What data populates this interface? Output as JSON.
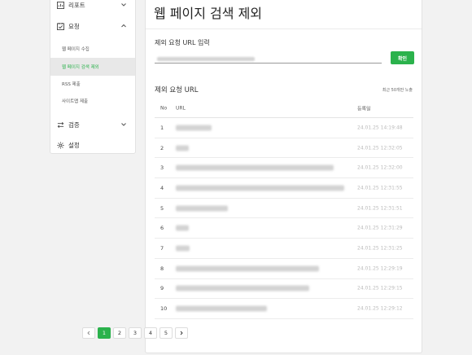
{
  "sidebar": {
    "items": [
      {
        "label": "리포트",
        "icon": "report-icon"
      },
      {
        "label": "요청",
        "icon": "request-icon"
      },
      {
        "label": "검증",
        "icon": "verify-icon"
      },
      {
        "label": "설정",
        "icon": "gear-icon"
      }
    ],
    "sub_items": [
      {
        "label": "웹 페이지 수집"
      },
      {
        "label": "웹 페이지 검색 제외"
      },
      {
        "label": "RSS 제출"
      },
      {
        "label": "사이트맵 제출"
      }
    ]
  },
  "main": {
    "title": "웹 페이지 검색 제외",
    "input_label": "제외 요청 URL 입력",
    "input_value": "",
    "confirm_label": "확인",
    "list_title": "제외 요청 URL",
    "list_note": "최근 50개만 노출",
    "columns": [
      "No",
      "URL",
      "등록일"
    ],
    "rows": [
      {
        "no": "1",
        "date": "24.01.25 14:19:48"
      },
      {
        "no": "2",
        "date": "24.01.25 12:32:05"
      },
      {
        "no": "3",
        "date": "24.01.25 12:32:00"
      },
      {
        "no": "4",
        "date": "24.01.25 12:31:55"
      },
      {
        "no": "5",
        "date": "24.01.25 12:31:51"
      },
      {
        "no": "6",
        "date": "24.01.25 12:31:29"
      },
      {
        "no": "7",
        "date": "24.01.25 12:31:25"
      },
      {
        "no": "8",
        "date": "24.01.25 12:29:19"
      },
      {
        "no": "9",
        "date": "24.01.25 12:29:15"
      },
      {
        "no": "10",
        "date": "24.01.25 12:29:12"
      }
    ],
    "pages": [
      "1",
      "2",
      "3",
      "4",
      "5"
    ],
    "current_page": "1"
  },
  "colors": {
    "accent": "#2bb24c",
    "background": "#f2f2f2"
  }
}
